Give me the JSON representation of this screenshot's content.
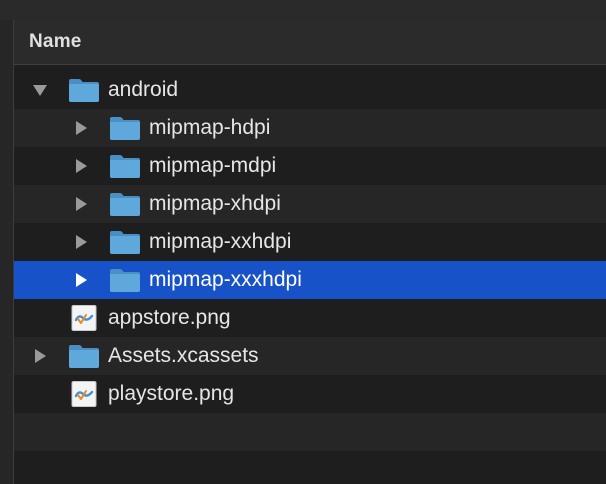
{
  "window": {
    "column_header": "Name"
  },
  "rows": [
    {
      "label": "android",
      "depth": 0,
      "type": "folder",
      "expanded": true,
      "selected": false
    },
    {
      "label": "mipmap-hdpi",
      "depth": 1,
      "type": "folder",
      "expanded": false,
      "selected": false
    },
    {
      "label": "mipmap-mdpi",
      "depth": 1,
      "type": "folder",
      "expanded": false,
      "selected": false
    },
    {
      "label": "mipmap-xhdpi",
      "depth": 1,
      "type": "folder",
      "expanded": false,
      "selected": false
    },
    {
      "label": "mipmap-xxhdpi",
      "depth": 1,
      "type": "folder",
      "expanded": false,
      "selected": false
    },
    {
      "label": "mipmap-xxxhdpi",
      "depth": 1,
      "type": "folder",
      "expanded": false,
      "selected": true
    },
    {
      "label": "appstore.png",
      "depth": 0,
      "type": "png",
      "selected": false
    },
    {
      "label": "Assets.xcassets",
      "depth": 0,
      "type": "folder",
      "expanded": false,
      "selected": false
    },
    {
      "label": "playstore.png",
      "depth": 0,
      "type": "png",
      "selected": false
    }
  ],
  "colors": {
    "selection": "#1852c9",
    "folder": "#5fa8dc",
    "folder_dark": "#4a8fc4",
    "background": "#1e1e1e",
    "row_alt": "#262626"
  },
  "icons": {
    "folder": "folder-icon",
    "png": "png-file-icon",
    "expanded": "triangle-down-icon",
    "collapsed": "triangle-right-icon"
  }
}
